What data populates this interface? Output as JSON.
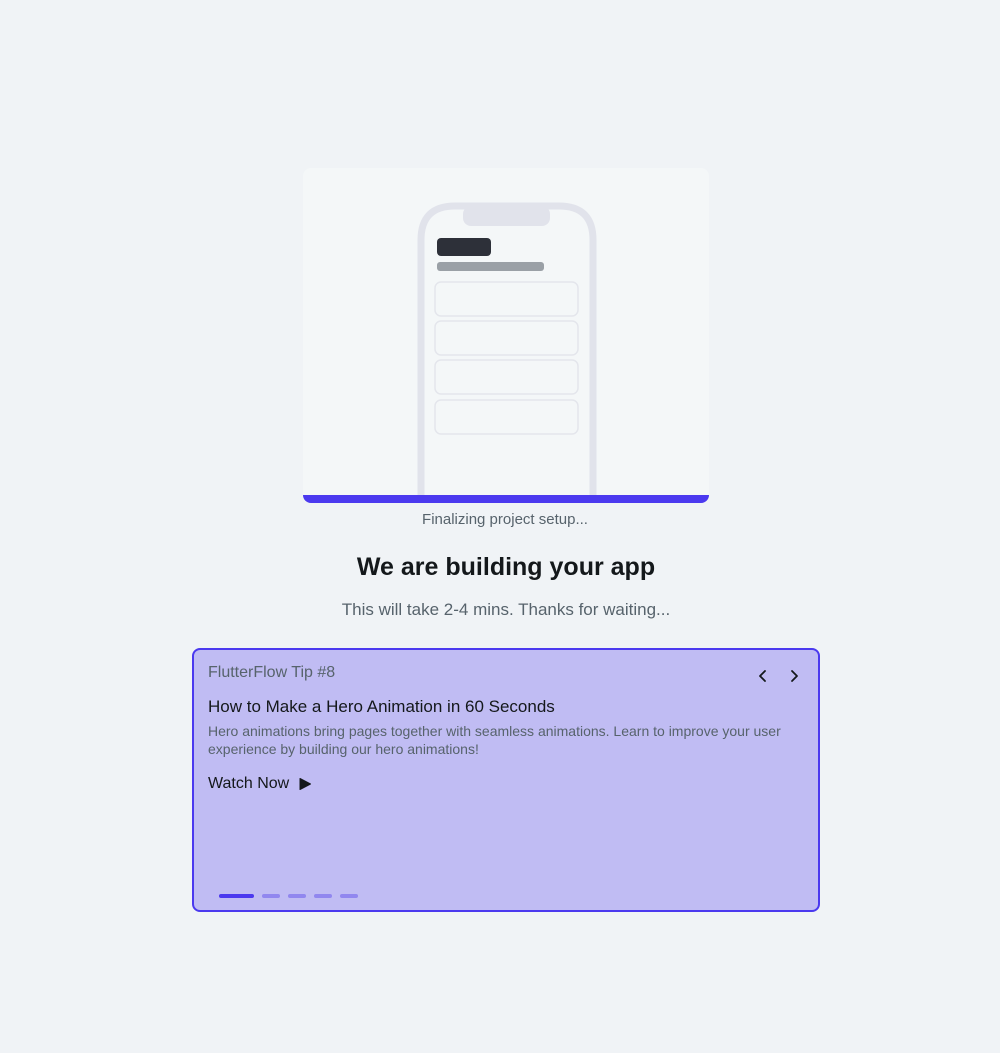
{
  "build": {
    "status": "Finalizing project setup...",
    "progress": 1.0,
    "title": "We are building your app",
    "subtitle": "This will take 2-4 mins. Thanks for waiting..."
  },
  "tip": {
    "number_label": "FlutterFlow Tip #8",
    "title": "How to Make a Hero Animation in 60 Seconds",
    "description": "Hero animations bring pages together with seamless animations. Learn to improve your user experience by building our hero animations!",
    "watch_label": "Watch Now",
    "icons": {
      "prev": "chevron-left-icon",
      "next": "chevron-right-icon",
      "watch": "play-icon"
    },
    "page_count": 5,
    "active_page": 0
  },
  "colors": {
    "accent": "#4b39ef",
    "tip_background": "#c0bcf3",
    "page_background": "#f0f3f6"
  }
}
